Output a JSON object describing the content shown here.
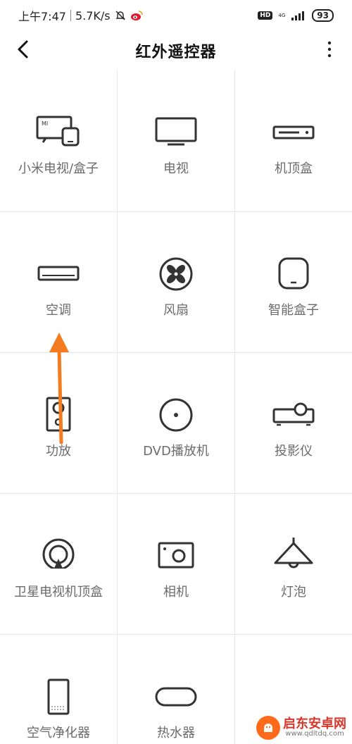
{
  "status_bar": {
    "time": "上午7:47",
    "speed": "5.7K/s",
    "hd": "HD",
    "network": "4G",
    "battery": "93"
  },
  "header": {
    "title": "红外遥控器"
  },
  "devices": [
    {
      "label": "小米电视/盒子",
      "icon": "mi-tv-box-icon"
    },
    {
      "label": "电视",
      "icon": "tv-icon"
    },
    {
      "label": "机顶盒",
      "icon": "set-top-box-icon"
    },
    {
      "label": "空调",
      "icon": "air-conditioner-icon"
    },
    {
      "label": "风扇",
      "icon": "fan-icon"
    },
    {
      "label": "智能盒子",
      "icon": "smart-box-icon"
    },
    {
      "label": "功放",
      "icon": "amplifier-icon"
    },
    {
      "label": "DVD播放机",
      "icon": "dvd-player-icon"
    },
    {
      "label": "投影仪",
      "icon": "projector-icon"
    },
    {
      "label": "卫星电视机顶盒",
      "icon": "satellite-tv-icon"
    },
    {
      "label": "相机",
      "icon": "camera-icon"
    },
    {
      "label": "灯泡",
      "icon": "lamp-icon"
    },
    {
      "label": "空气净化器",
      "icon": "air-purifier-icon"
    },
    {
      "label": "热水器",
      "icon": "water-heater-icon"
    }
  ],
  "watermark": {
    "name": "启东安卓网",
    "url": "www.qdltdq.com"
  },
  "colors": {
    "annotation_arrow": "#f47b20",
    "icon_stroke": "#333333",
    "label_text": "#6b6b6b"
  }
}
